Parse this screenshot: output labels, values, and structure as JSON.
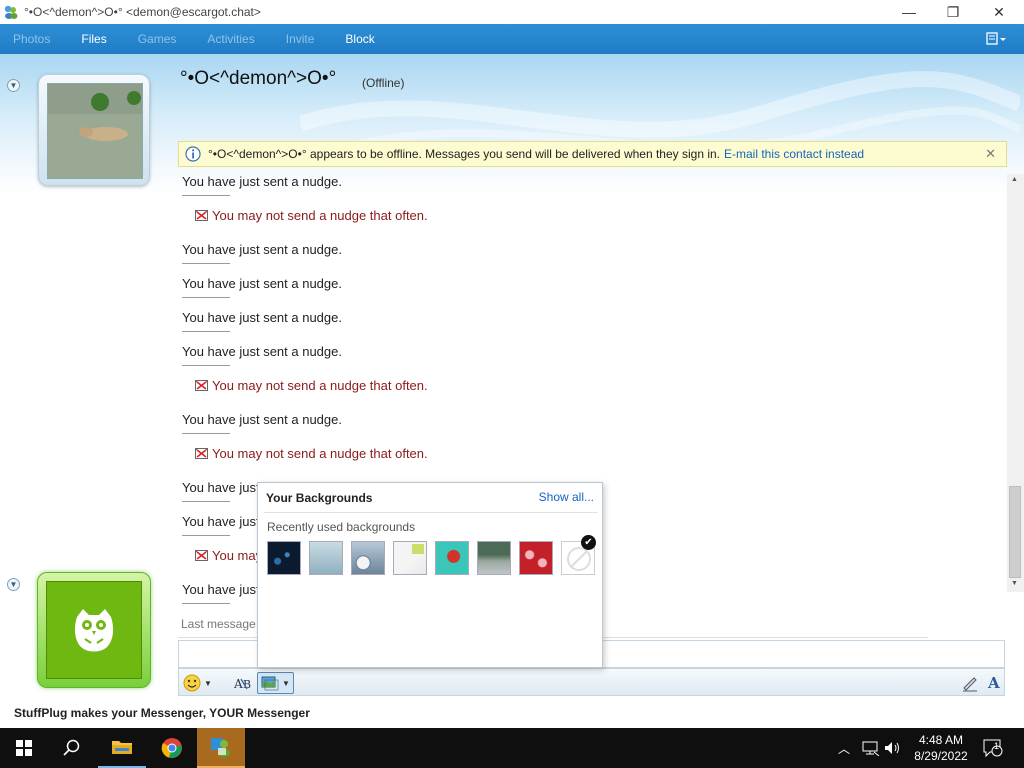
{
  "window": {
    "title": "°•Ο<^demon^>Ο•° <demon@escargot.chat>",
    "minimize_glyph": "—",
    "maximize_glyph": "❐",
    "close_glyph": "✕"
  },
  "toolbar": {
    "items": [
      {
        "label": "Photos",
        "enabled": false
      },
      {
        "label": "Files",
        "enabled": true
      },
      {
        "label": "Games",
        "enabled": false
      },
      {
        "label": "Activities",
        "enabled": false
      },
      {
        "label": "Invite",
        "enabled": false
      },
      {
        "label": "Block",
        "enabled": true
      }
    ],
    "menu_icon": "menu-dropdown-icon"
  },
  "contact": {
    "name": "°•Ο<^demon^>Ο•°",
    "status": "(Offline)"
  },
  "infobar": {
    "message": "°•Ο<^demon^>Ο•° appears to be offline. Messages you send will be delivered when they sign in.",
    "link": "E-mail this contact instead",
    "close_glyph": "✕"
  },
  "conversation": {
    "nudge_text": "You have just sent a nudge.",
    "warning_text": "You may not send a nudge that often.",
    "messages": [
      {
        "type": "nudge",
        "text": "You have just sent a nudge."
      },
      {
        "type": "warning",
        "text": "You may not send a nudge that often."
      },
      {
        "type": "nudge",
        "text": "You have just sent a nudge."
      },
      {
        "type": "nudge",
        "text": "You have just sent a nudge."
      },
      {
        "type": "nudge",
        "text": "You have just sent a nudge."
      },
      {
        "type": "nudge",
        "text": "You have just sent a nudge."
      },
      {
        "type": "warning",
        "text": "You may not send a nudge that often."
      },
      {
        "type": "nudge",
        "text": "You have just sent a nudge."
      },
      {
        "type": "warning",
        "text": "You may not send a nudge that often."
      },
      {
        "type": "nudge",
        "text": "You have just"
      },
      {
        "type": "nudge",
        "text": "You have just"
      },
      {
        "type": "warning",
        "text": "You may"
      },
      {
        "type": "nudge",
        "text": "You have just"
      }
    ],
    "last_message_text": "Last message r"
  },
  "backgrounds_popup": {
    "title": "Your Backgrounds",
    "show_all": "Show all...",
    "subtitle": "Recently used backgrounds",
    "thumbnails": [
      {
        "name": "dark-blue-bubbles",
        "colors": [
          "#0b1a2e",
          "#2a6fa8"
        ]
      },
      {
        "name": "paper-figure",
        "colors": [
          "#c9dbe3",
          "#6f8f9c"
        ]
      },
      {
        "name": "stopwatch",
        "colors": [
          "#b7c7d8",
          "#5e7890"
        ]
      },
      {
        "name": "green-note",
        "colors": [
          "#f4f4f4",
          "#c8e06a"
        ]
      },
      {
        "name": "teal-red-fish",
        "colors": [
          "#3ac6b9",
          "#d2342a"
        ]
      },
      {
        "name": "garden",
        "colors": [
          "#4c6b57",
          "#c0c6c8"
        ]
      },
      {
        "name": "red-hearts",
        "colors": [
          "#c4202a",
          "#f1b4b8"
        ]
      },
      {
        "name": "no-background",
        "colors": [
          "#ffffff",
          "#dddddd"
        ]
      }
    ],
    "selected_index": 7
  },
  "input_tools": {
    "emoticon_icon": "emoticon-icon",
    "spellcheck_icon": "spellcheck-icon",
    "background_icon": "background-icon",
    "handwriting_icon": "handwriting-icon",
    "font_icon": "font-icon",
    "font_glyph": "A"
  },
  "footer": {
    "text": "StuffPlug makes your Messenger, YOUR Messenger"
  },
  "taskbar": {
    "time": "4:48 AM",
    "date": "8/29/2022",
    "notification_count": "1",
    "apps": [
      "windows-start-icon",
      "search-icon",
      "file-explorer-icon",
      "chrome-icon",
      "messenger-icon"
    ]
  },
  "colors": {
    "toolbar_bg": "#1e7cc5",
    "link": "#1565c0",
    "warning_text": "#8b1a1a",
    "user_avatar": "#6fb812"
  }
}
